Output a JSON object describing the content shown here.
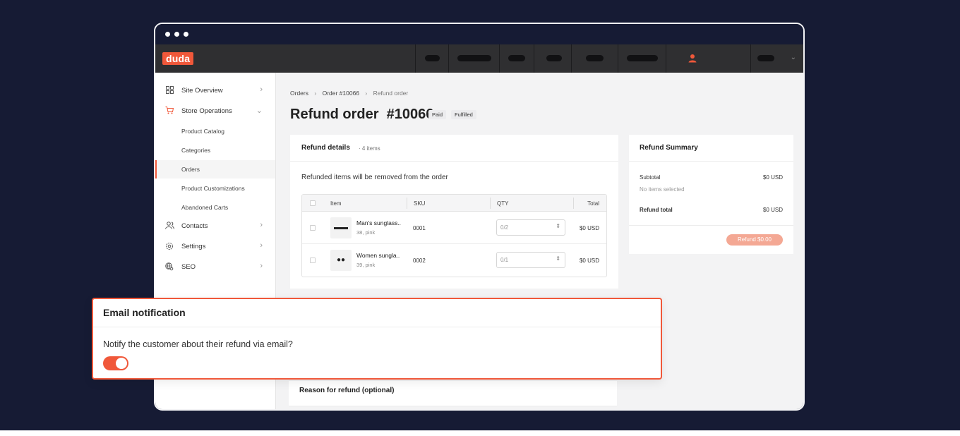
{
  "window": {
    "title_dots": 3
  },
  "topnav": {
    "logo": "duda"
  },
  "sidebar": {
    "items": [
      {
        "label": "Site Overview",
        "icon": "grid-icon"
      },
      {
        "label": "Store Operations",
        "icon": "cart-icon"
      },
      {
        "label": "Contacts",
        "icon": "users-icon"
      },
      {
        "label": "Settings",
        "icon": "gear-icon"
      },
      {
        "label": "SEO",
        "icon": "globe-search-icon"
      }
    ],
    "subitems": [
      {
        "label": "Product Catalog"
      },
      {
        "label": "Categories"
      },
      {
        "label": "Orders",
        "active": true
      },
      {
        "label": "Product Customizations"
      },
      {
        "label": "Abandoned Carts"
      }
    ]
  },
  "breadcrumb": {
    "a": "Orders",
    "b": "Order #10066",
    "c": "Refund order"
  },
  "page": {
    "title": "Refund order  #10066",
    "badge_paid": "Paid",
    "badge_fulfilled": "Fulfilled"
  },
  "refund_details": {
    "title": "Refund details",
    "count": "4 items",
    "note": "Refunded items will be removed from the order",
    "columns": {
      "item": "Item",
      "sku": "SKU",
      "qty": "QTY",
      "total": "Total"
    },
    "rows": [
      {
        "name": "Man's sunglass..",
        "variant": "38, pink",
        "sku": "0001",
        "qty": "0/2",
        "total": "$0 USD"
      },
      {
        "name": "Women sungla..",
        "variant": "39, pink",
        "sku": "0002",
        "qty": "0/1",
        "total": "$0 USD"
      }
    ]
  },
  "summary": {
    "title": "Refund Summary",
    "subtotal_label": "Subtotal",
    "subtotal_value": "$0 USD",
    "no_items": "No items selected",
    "total_label": "Refund total",
    "total_value": "$0 USD",
    "button": "Refund $0.00"
  },
  "email": {
    "title": "Email notification",
    "question": "Notify the customer about their refund via email?",
    "enabled": true
  },
  "reason": {
    "label": "Reason for refund (optional)"
  },
  "colors": {
    "accent": "#f0583a",
    "background": "#161b34",
    "topnav": "#2f2f31"
  }
}
